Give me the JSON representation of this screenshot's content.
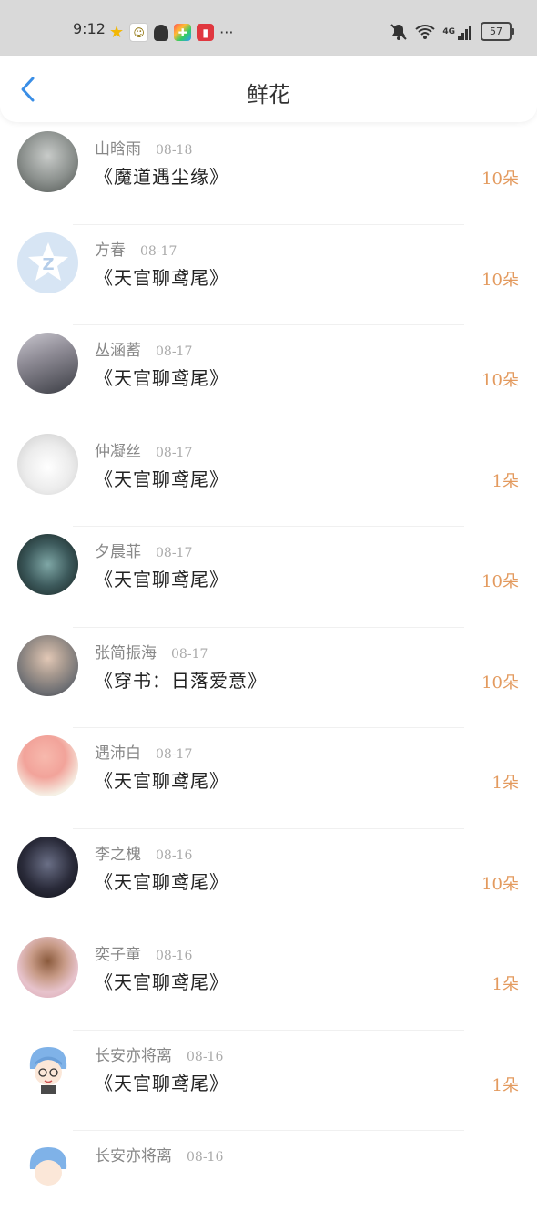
{
  "status": {
    "time": "9:12",
    "more": "···",
    "battery": "57",
    "network": "4G"
  },
  "header": {
    "title": "鲜花"
  },
  "items": [
    {
      "name": "山晗雨",
      "date": "08-18",
      "book": "《魔道遇尘缘》",
      "count": "10朵",
      "avatar_color": "#8a8f8c"
    },
    {
      "name": "方春",
      "date": "08-17",
      "book": "《天官聊鸢尾》",
      "count": "10朵",
      "avatar_color": "#d7e5f4"
    },
    {
      "name": "丛涵蓄",
      "date": "08-17",
      "book": "《天官聊鸢尾》",
      "count": "10朵",
      "avatar_color": "#7c7f88"
    },
    {
      "name": "仲凝丝",
      "date": "08-17",
      "book": "《天官聊鸢尾》",
      "count": "1朵",
      "avatar_color": "#e6e6e6"
    },
    {
      "name": "夕晨菲",
      "date": "08-17",
      "book": "《天官聊鸢尾》",
      "count": "10朵",
      "avatar_color": "#3d5a5c"
    },
    {
      "name": "张简振海",
      "date": "08-17",
      "book": "《穿书：日落爱意》",
      "count": "10朵",
      "avatar_color": "#6e6f73"
    },
    {
      "name": "遇沛白",
      "date": "08-17",
      "book": "《天官聊鸢尾》",
      "count": "1朵",
      "avatar_color": "#f2a39a"
    },
    {
      "name": "李之槐",
      "date": "08-16",
      "book": "《天官聊鸢尾》",
      "count": "10朵",
      "avatar_color": "#2a2b3a"
    },
    {
      "name": "奕子童",
      "date": "08-16",
      "book": "《天官聊鸢尾》",
      "count": "1朵",
      "avatar_color": "#d9a4b2"
    },
    {
      "name": "长安亦将离",
      "date": "08-16",
      "book": "《天官聊鸢尾》",
      "count": "1朵",
      "avatar_color": "#7fb2e8"
    },
    {
      "name": "长安亦将离",
      "date": "08-16",
      "book": "",
      "count": "",
      "avatar_color": "#7fb2e8"
    }
  ]
}
